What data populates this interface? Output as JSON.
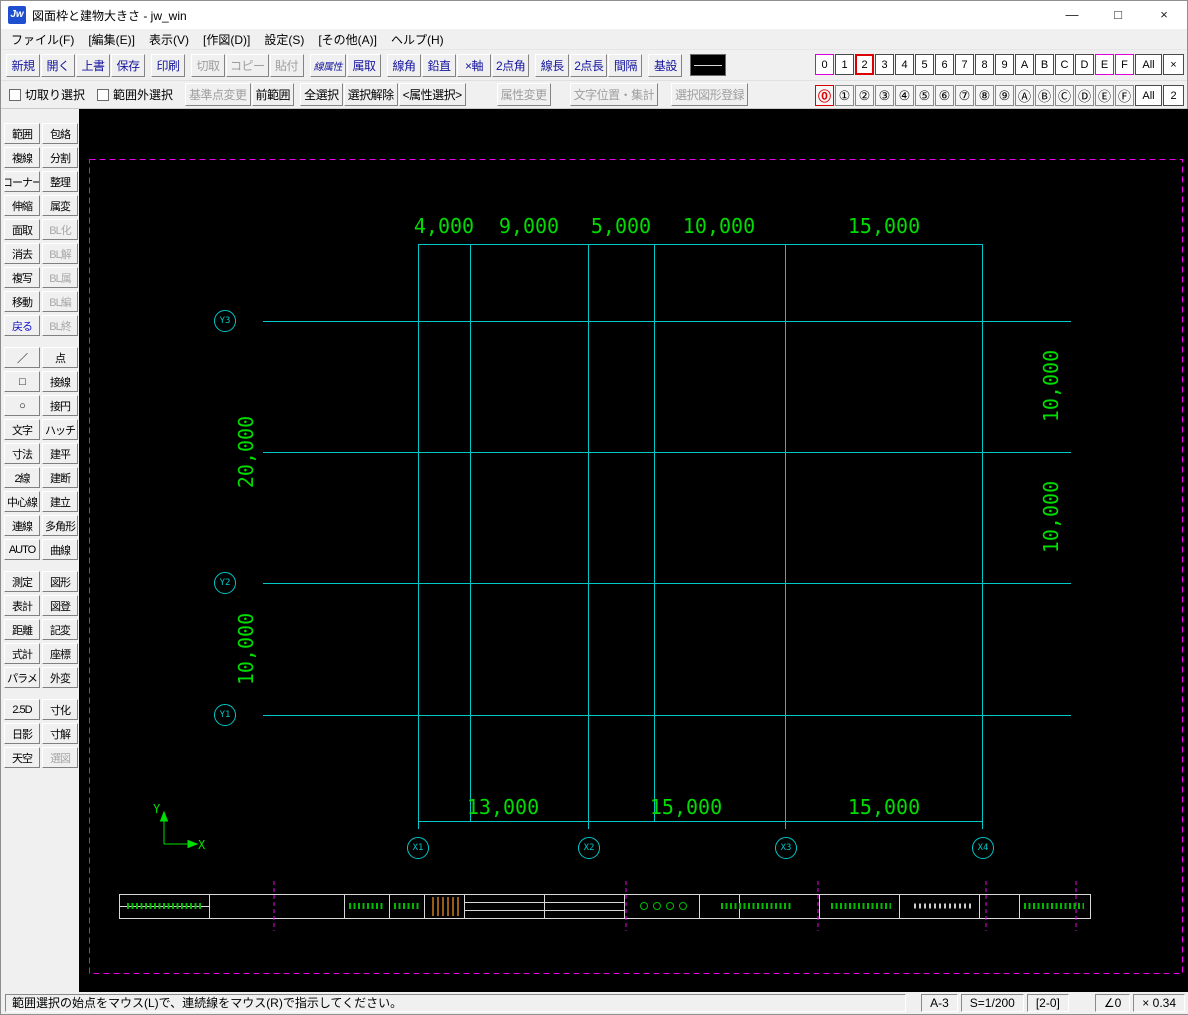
{
  "titlebar": {
    "icon_text": "Jw",
    "title": "図面枠と建物大きさ - jw_win",
    "minimize": "—",
    "maximize": "□",
    "close": "×"
  },
  "menubar": {
    "items": [
      "ファイル(F)",
      "[編集(E)]",
      "表示(V)",
      "[作図(D)]",
      "設定(S)",
      "[その他(A)]",
      "ヘルプ(H)"
    ]
  },
  "toolbar1": {
    "groups": [
      {
        "name": "file",
        "buttons": [
          {
            "label": "新規",
            "state": "blue"
          },
          {
            "label": "開く",
            "state": "blue"
          },
          {
            "label": "上書",
            "state": "blue"
          },
          {
            "label": "保存",
            "state": "blue"
          }
        ]
      },
      {
        "name": "print",
        "buttons": [
          {
            "label": "印刷",
            "state": "blue"
          }
        ]
      },
      {
        "name": "clipboard",
        "buttons": [
          {
            "label": "切取",
            "state": "disabled"
          },
          {
            "label": "コピー",
            "state": "disabled"
          },
          {
            "label": "貼付",
            "state": "disabled"
          }
        ]
      },
      {
        "name": "attribute",
        "buttons": [
          {
            "label": "線属性",
            "state": "blue-italic"
          },
          {
            "label": "属取",
            "state": "blue"
          }
        ]
      },
      {
        "name": "angle",
        "buttons": [
          {
            "label": "線角",
            "state": "blue"
          },
          {
            "label": "鉛直",
            "state": "blue"
          },
          {
            "label": "×軸",
            "state": "blue"
          },
          {
            "label": "2点角",
            "state": "blue"
          }
        ]
      },
      {
        "name": "length",
        "buttons": [
          {
            "label": "線長",
            "state": "blue"
          },
          {
            "label": "2点長",
            "state": "blue"
          },
          {
            "label": "間隔",
            "state": "blue"
          }
        ]
      },
      {
        "name": "base",
        "buttons": [
          {
            "label": "基設",
            "state": "blue"
          }
        ]
      }
    ],
    "layer_groups": {
      "buttons": [
        {
          "label": "0",
          "state": "magenta"
        },
        {
          "label": "1",
          "state": "normal"
        },
        {
          "label": "2",
          "state": "selected"
        },
        {
          "label": "3",
          "state": "normal"
        },
        {
          "label": "4",
          "state": "normal"
        },
        {
          "label": "5",
          "state": "normal"
        },
        {
          "label": "6",
          "state": "normal"
        },
        {
          "label": "7",
          "state": "normal"
        },
        {
          "label": "8",
          "state": "normal"
        },
        {
          "label": "9",
          "state": "normal"
        },
        {
          "label": "A",
          "state": "normal"
        },
        {
          "label": "B",
          "state": "normal"
        },
        {
          "label": "C",
          "state": "normal"
        },
        {
          "label": "D",
          "state": "normal"
        },
        {
          "label": "E",
          "state": "magenta"
        },
        {
          "label": "F",
          "state": "magenta"
        }
      ],
      "all_label": "All",
      "close_label": "×"
    }
  },
  "toolbar2": {
    "checkboxes": [
      {
        "label": "切取り選択",
        "checked": false
      },
      {
        "label": "範囲外選択",
        "checked": false
      }
    ],
    "buttons": [
      {
        "label": "基準点変更",
        "state": "disabled"
      },
      {
        "label": "前範囲",
        "state": "normal"
      },
      {
        "label": "全選択",
        "state": "normal"
      },
      {
        "label": "選択解除",
        "state": "normal"
      },
      {
        "label": "<属性選択>",
        "state": "normal"
      },
      {
        "label": "属性変更",
        "state": "disabled"
      },
      {
        "label": "文字位置・集計",
        "state": "disabled"
      },
      {
        "label": "選択図形登録",
        "state": "disabled"
      }
    ],
    "layers": {
      "buttons": [
        {
          "label": "⓪",
          "state": "selected"
        },
        {
          "label": "①",
          "state": "normal"
        },
        {
          "label": "②",
          "state": "normal"
        },
        {
          "label": "③",
          "state": "normal"
        },
        {
          "label": "④",
          "state": "normal"
        },
        {
          "label": "⑤",
          "state": "normal"
        },
        {
          "label": "⑥",
          "state": "normal"
        },
        {
          "label": "⑦",
          "state": "normal"
        },
        {
          "label": "⑧",
          "state": "normal"
        },
        {
          "label": "⑨",
          "state": "normal"
        },
        {
          "label": "Ⓐ",
          "state": "normal"
        },
        {
          "label": "Ⓑ",
          "state": "normal"
        },
        {
          "label": "Ⓒ",
          "state": "normal"
        },
        {
          "label": "Ⓓ",
          "state": "normal"
        },
        {
          "label": "Ⓔ",
          "state": "normal"
        },
        {
          "label": "Ⓕ",
          "state": "normal"
        }
      ],
      "all_label": "All",
      "group_label": "2"
    }
  },
  "sidebar": {
    "group1": [
      {
        "label": "範囲",
        "state": "normal"
      },
      {
        "label": "包絡",
        "state": "normal"
      },
      {
        "label": "複線",
        "state": "normal"
      },
      {
        "label": "分割",
        "state": "normal"
      },
      {
        "label": "コーナー",
        "state": "normal"
      },
      {
        "label": "整理",
        "state": "normal"
      },
      {
        "label": "伸縮",
        "state": "normal"
      },
      {
        "label": "属変",
        "state": "normal"
      },
      {
        "label": "面取",
        "state": "normal"
      },
      {
        "label": "BL化",
        "state": "disabled"
      },
      {
        "label": "消去",
        "state": "normal"
      },
      {
        "label": "BL解",
        "state": "disabled"
      },
      {
        "label": "複写",
        "state": "normal"
      },
      {
        "label": "BL属",
        "state": "disabled"
      },
      {
        "label": "移動",
        "state": "normal"
      },
      {
        "label": "BL編",
        "state": "disabled"
      },
      {
        "label": "戻る",
        "state": "blue"
      },
      {
        "label": "BL終",
        "state": "disabled"
      }
    ],
    "group2": [
      {
        "label": "／",
        "state": "normal"
      },
      {
        "label": "点",
        "state": "normal"
      },
      {
        "label": "□",
        "state": "normal"
      },
      {
        "label": "接線",
        "state": "normal"
      },
      {
        "label": "○",
        "state": "normal"
      },
      {
        "label": "接円",
        "state": "normal"
      },
      {
        "label": "文字",
        "state": "normal"
      },
      {
        "label": "ハッチ",
        "state": "normal"
      },
      {
        "label": "寸法",
        "state": "normal"
      },
      {
        "label": "建平",
        "state": "normal"
      },
      {
        "label": "2線",
        "state": "normal"
      },
      {
        "label": "建断",
        "state": "normal"
      },
      {
        "label": "中心線",
        "state": "normal"
      },
      {
        "label": "建立",
        "state": "normal"
      },
      {
        "label": "連線",
        "state": "normal"
      },
      {
        "label": "多角形",
        "state": "normal"
      },
      {
        "label": "AUTO",
        "state": "normal"
      },
      {
        "label": "曲線",
        "state": "normal"
      }
    ],
    "group3": [
      {
        "label": "測定",
        "state": "normal"
      },
      {
        "label": "図形",
        "state": "normal"
      },
      {
        "label": "表計",
        "state": "normal"
      },
      {
        "label": "図登",
        "state": "normal"
      },
      {
        "label": "距離",
        "state": "normal"
      },
      {
        "label": "記変",
        "state": "normal"
      },
      {
        "label": "式計",
        "state": "normal"
      },
      {
        "label": "座標",
        "state": "normal"
      },
      {
        "label": "パラメ",
        "state": "normal"
      },
      {
        "label": "外変",
        "state": "normal"
      }
    ],
    "group4": [
      {
        "label": "2.5D",
        "state": "normal"
      },
      {
        "label": "寸化",
        "state": "normal"
      },
      {
        "label": "日影",
        "state": "normal"
      },
      {
        "label": "寸解",
        "state": "normal"
      },
      {
        "label": "天空",
        "state": "normal"
      },
      {
        "label": "選図",
        "state": "disabled"
      }
    ]
  },
  "canvas": {
    "dims_top": [
      "4,000",
      "9,000",
      "5,000",
      "10,000",
      "15,000"
    ],
    "dims_bottom": [
      "13,000",
      "15,000",
      "15,000"
    ],
    "dims_left": [
      "20,000",
      "10,000"
    ],
    "dims_right": [
      "10,000",
      "10,000"
    ],
    "axes_y": [
      "Y3",
      "Y2",
      "Y1"
    ],
    "axes_x": [
      "X1",
      "X2",
      "X3",
      "X4"
    ],
    "origin_labels": {
      "x": "X",
      "y": "Y"
    },
    "colors": {
      "background": "#000000",
      "grid": "#00c8c8",
      "dimension_text": "#00dd00",
      "frame": "#e800e8",
      "title_block": "#d8d8d8",
      "hatch": "#cc7a1e"
    }
  },
  "statusbar": {
    "message": "範囲選択の始点をマウス(L)で、連続線をマウス(R)で指示してください。",
    "paper_size": "A-3",
    "scale": "S=1/200",
    "layer": "[2-0]",
    "angle": "∠0",
    "zoom": "× 0.34"
  }
}
